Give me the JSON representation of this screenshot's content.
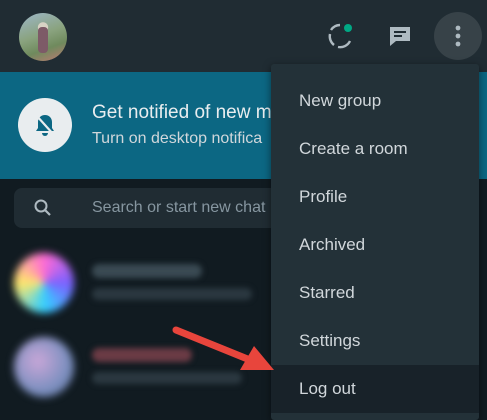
{
  "header": {
    "avatar": "profile-photo",
    "icons": [
      "status-icon",
      "new-chat-icon",
      "menu-dots-icon"
    ]
  },
  "notification": {
    "title": "Get notified of new m",
    "subtitle": "Turn on desktop notifica",
    "icon": "bell-off-icon"
  },
  "search": {
    "placeholder": "Search or start new chat",
    "icon": "search-icon"
  },
  "menu": {
    "items": [
      "New group",
      "Create a room",
      "Profile",
      "Archived",
      "Starred",
      "Settings",
      "Log out"
    ],
    "highlighted": "Log out"
  },
  "colors": {
    "header_bg": "#202c33",
    "banner_bg": "#0c6783",
    "menu_bg": "#233138",
    "app_bg": "#111b21",
    "status_dot": "#00a884",
    "arrow": "#e8453c"
  }
}
